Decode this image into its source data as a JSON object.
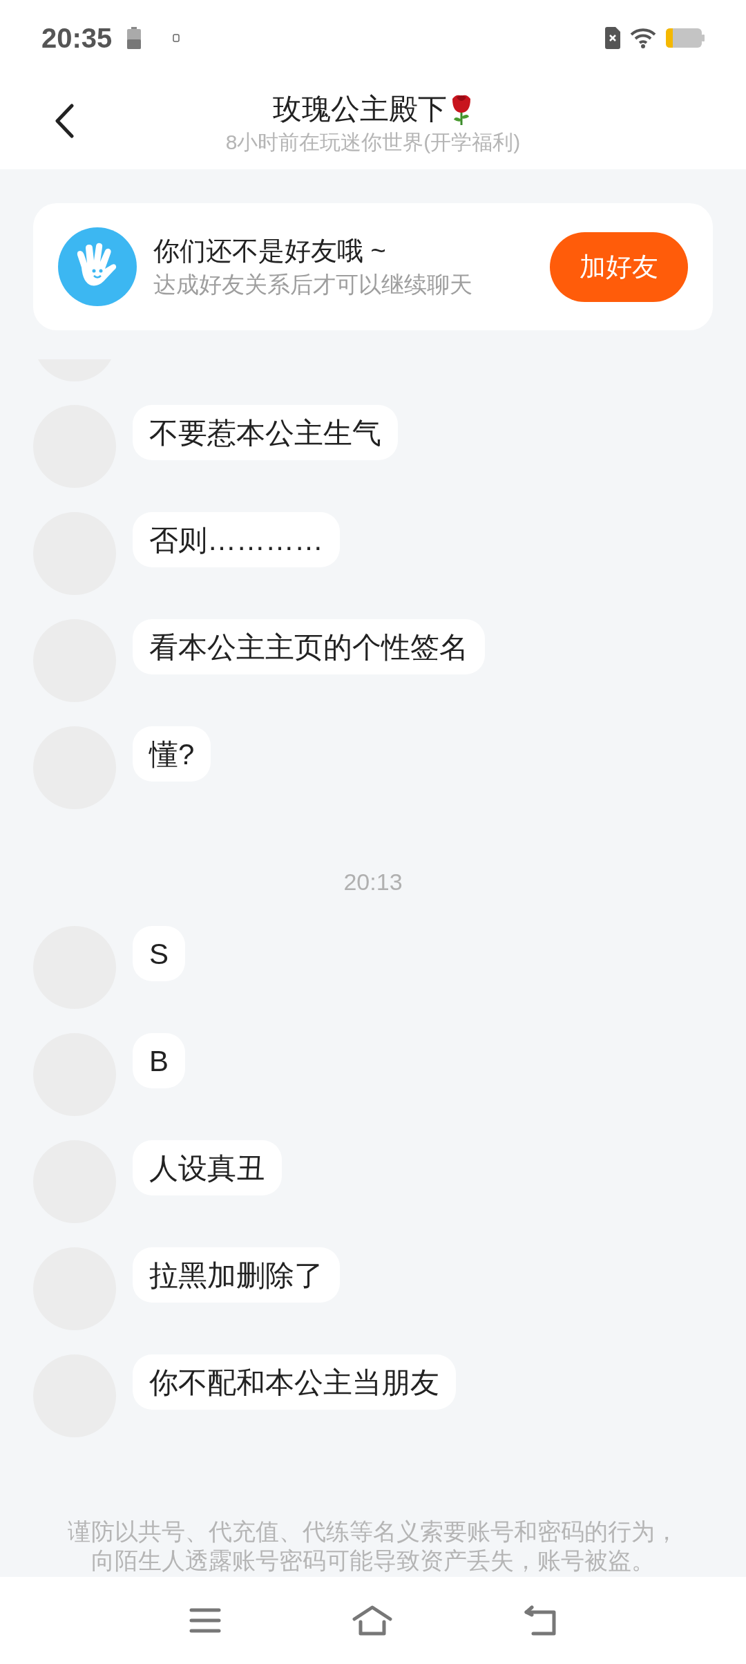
{
  "status_bar": {
    "time": "20:35"
  },
  "header": {
    "title": "玫瑰公主殿下",
    "subtitle": "8小时前在玩迷你世界(开学福利)"
  },
  "friend_notice": {
    "title": "你们还不是好友哦 ~",
    "subtitle": "达成好友关系后才可以继续聊天",
    "button": "加好友"
  },
  "messages": [
    {
      "kind": "message",
      "text": "不要惹本公主生气"
    },
    {
      "kind": "message",
      "text": "否则…………"
    },
    {
      "kind": "message",
      "text": "看本公主主页的个性签名"
    },
    {
      "kind": "message",
      "text": "懂?"
    },
    {
      "kind": "timestamp",
      "text": "20:13"
    },
    {
      "kind": "message",
      "text": "S"
    },
    {
      "kind": "message",
      "text": "B"
    },
    {
      "kind": "message",
      "text": "人设真丑"
    },
    {
      "kind": "message",
      "text": "拉黑加删除了"
    },
    {
      "kind": "message",
      "text": "你不配和本公主当朋友"
    }
  ],
  "warning_lines": [
    "谨防以共号、代充值、代练等名义索要账号和密码的行为，",
    "向陌生人透露账号密码可能导致资产丢失，账号被盗。"
  ]
}
